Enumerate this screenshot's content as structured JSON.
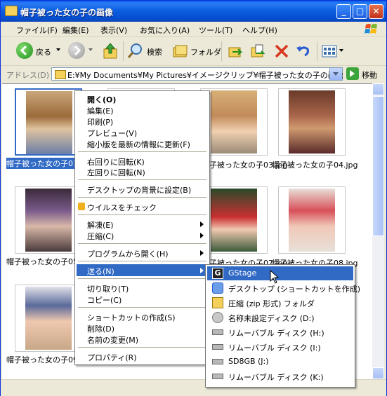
{
  "window": {
    "title": "帽子被った女の子の画像",
    "minimize_label": "_",
    "maximize_label": "□",
    "close_label": "✕"
  },
  "menubar": {
    "items": [
      "ファイル(F)",
      "編集(E)",
      "表示(V)",
      "お気に入り(A)",
      "ツール(T)",
      "ヘルプ(H)"
    ]
  },
  "toolbar": {
    "back_label": "戻る",
    "search_label": "検索",
    "folders_label": "フォルダ"
  },
  "address": {
    "label": "アドレス(D)",
    "value": "E:¥My Documents¥My Pictures¥イメージクリップ¥帽子被った女の子の画像",
    "go_label": "移動"
  },
  "files": [
    {
      "caption": "帽子被った女の子01",
      "selected": true
    },
    {
      "caption": "",
      "selected": false
    },
    {
      "caption": "帽子被った女の子03.jpg",
      "selected": false
    },
    {
      "caption": "帽子被った女の子04.jpg",
      "selected": false
    },
    {
      "caption": "帽子被った女の子05",
      "selected": false
    },
    {
      "caption": "",
      "selected": false
    },
    {
      "caption": "帽子被った女の子07.jpg",
      "selected": false
    },
    {
      "caption": "帽子被った女の子08.jpg",
      "selected": false
    },
    {
      "caption": "帽子被った女の子09",
      "selected": false
    }
  ],
  "context_menu": {
    "items": [
      {
        "label": "開く(O)",
        "bold": true
      },
      {
        "label": "編集(E)"
      },
      {
        "label": "印刷(P)"
      },
      {
        "label": "プレビュー(V)"
      },
      {
        "label": "縮小版を最新の情報に更新(F)"
      },
      {
        "label": "右回りに回転(K)"
      },
      {
        "label": "左回りに回転(N)"
      },
      {
        "label": "デスクトップの背景に設定(B)"
      },
      {
        "label": "ウイルスをチェック"
      },
      {
        "label": "解凍(E)",
        "submenu": true
      },
      {
        "label": "圧縮(C)",
        "submenu": true
      },
      {
        "label": "プログラムから開く(H)",
        "submenu": true
      },
      {
        "label": "送る(N)",
        "submenu": true,
        "highlighted": true
      },
      {
        "label": "切り取り(T)"
      },
      {
        "label": "コピー(C)"
      },
      {
        "label": "ショートカットの作成(S)"
      },
      {
        "label": "削除(D)"
      },
      {
        "label": "名前の変更(M)"
      },
      {
        "label": "プロパティ(R)"
      }
    ]
  },
  "sendto_menu": {
    "items": [
      {
        "label": "GStage",
        "icon": "gstage-icon",
        "icon_glyph": "G",
        "highlighted": true
      },
      {
        "label": "デスクトップ (ショートカットを作成)",
        "icon": "desktop-icon"
      },
      {
        "label": "圧縮 (zip 形式) フォルダ",
        "icon": "zip-folder-icon"
      },
      {
        "label": "名称未設定ディスク (D:)",
        "icon": "cd-drive-icon"
      },
      {
        "label": "リムーバブル ディスク (H:)",
        "icon": "removable-drive-icon"
      },
      {
        "label": "リムーバブル ディスク (I:)",
        "icon": "removable-drive-icon"
      },
      {
        "label": "SD8GB (J:)",
        "icon": "removable-drive-icon"
      },
      {
        "label": "リムーバブル ディスク (K:)",
        "icon": "removable-drive-icon"
      }
    ]
  },
  "colors": {
    "highlight": "#316ac5",
    "title_blue": "#0a5fe8",
    "window_bg": "#ece9d8"
  }
}
